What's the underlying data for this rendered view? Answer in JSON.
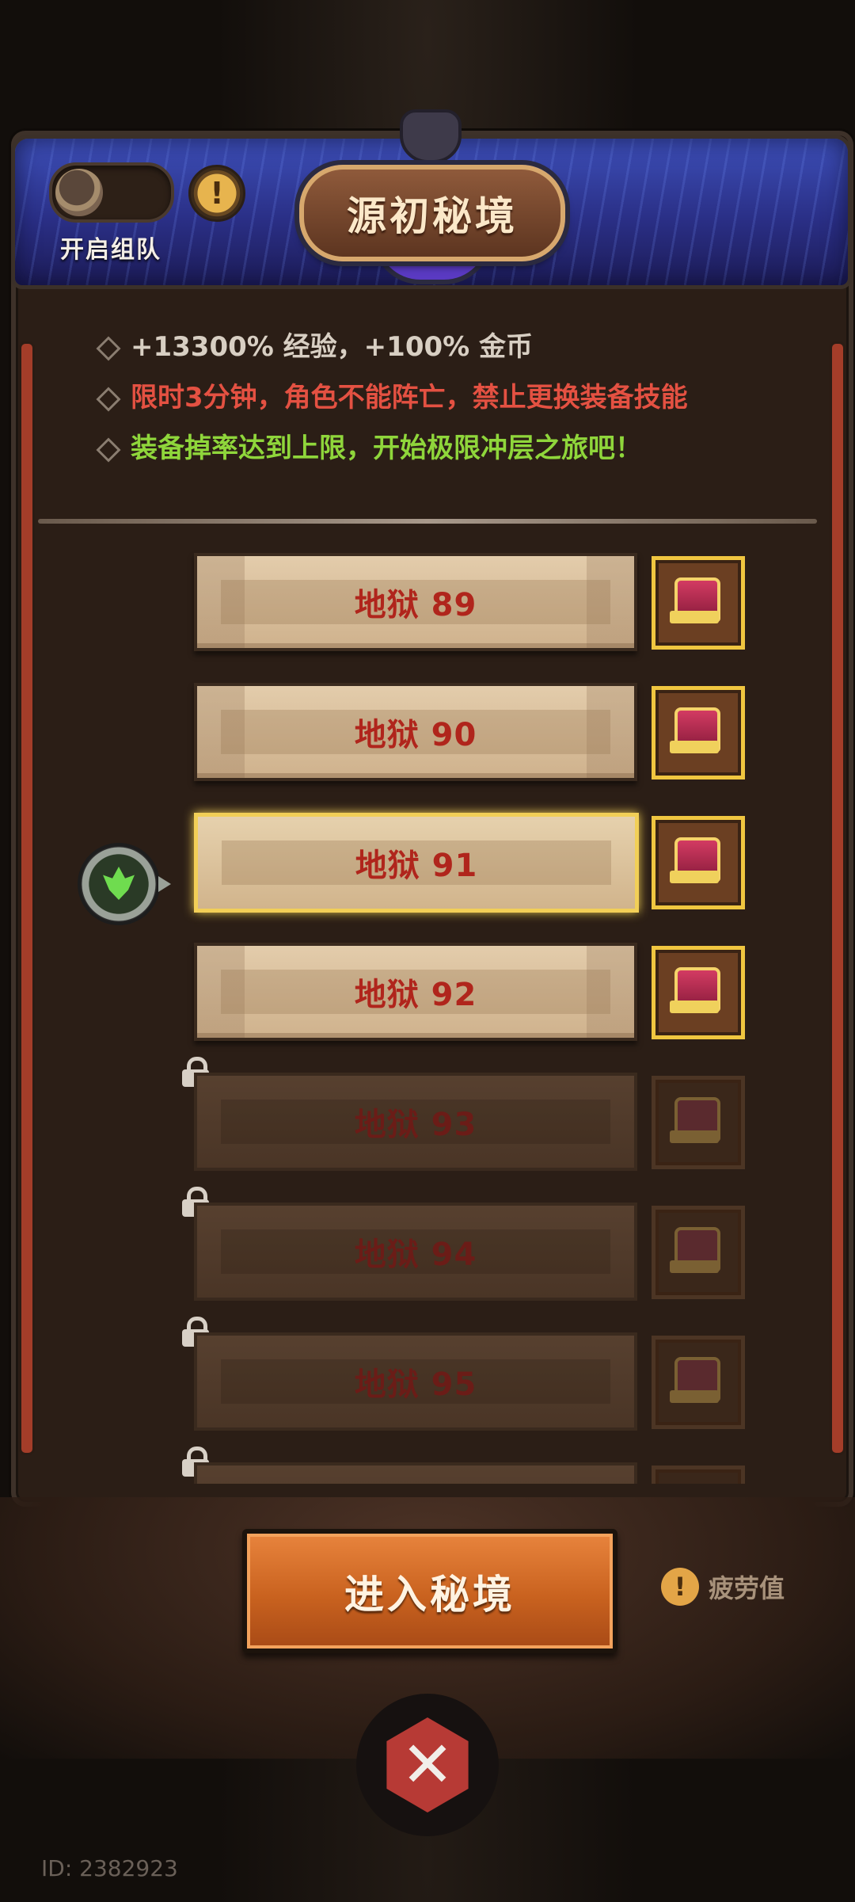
{
  "header": {
    "title": "源初秘境",
    "team_toggle_label": "开启组队",
    "info_icon": "!"
  },
  "info": {
    "line1": "+13300% 经验，+100% 金币",
    "line2": "限时3分钟，角色不能阵亡，禁止更换装备技能",
    "line3": "装备掉率达到上限，开始极限冲层之旅吧！"
  },
  "floors": [
    {
      "label": "地狱 89",
      "locked": false,
      "selected": false
    },
    {
      "label": "地狱 90",
      "locked": false,
      "selected": false
    },
    {
      "label": "地狱 91",
      "locked": false,
      "selected": true
    },
    {
      "label": "地狱 92",
      "locked": false,
      "selected": false
    },
    {
      "label": "地狱 93",
      "locked": true,
      "selected": false
    },
    {
      "label": "地狱 94",
      "locked": true,
      "selected": false
    },
    {
      "label": "地狱 95",
      "locked": true,
      "selected": false
    }
  ],
  "actions": {
    "enter_label": "进入秘境",
    "fatigue_label": "疲劳值",
    "fatigue_icon": "!",
    "close_icon": "✕"
  },
  "footer": {
    "user_id": "ID: 2382923"
  }
}
